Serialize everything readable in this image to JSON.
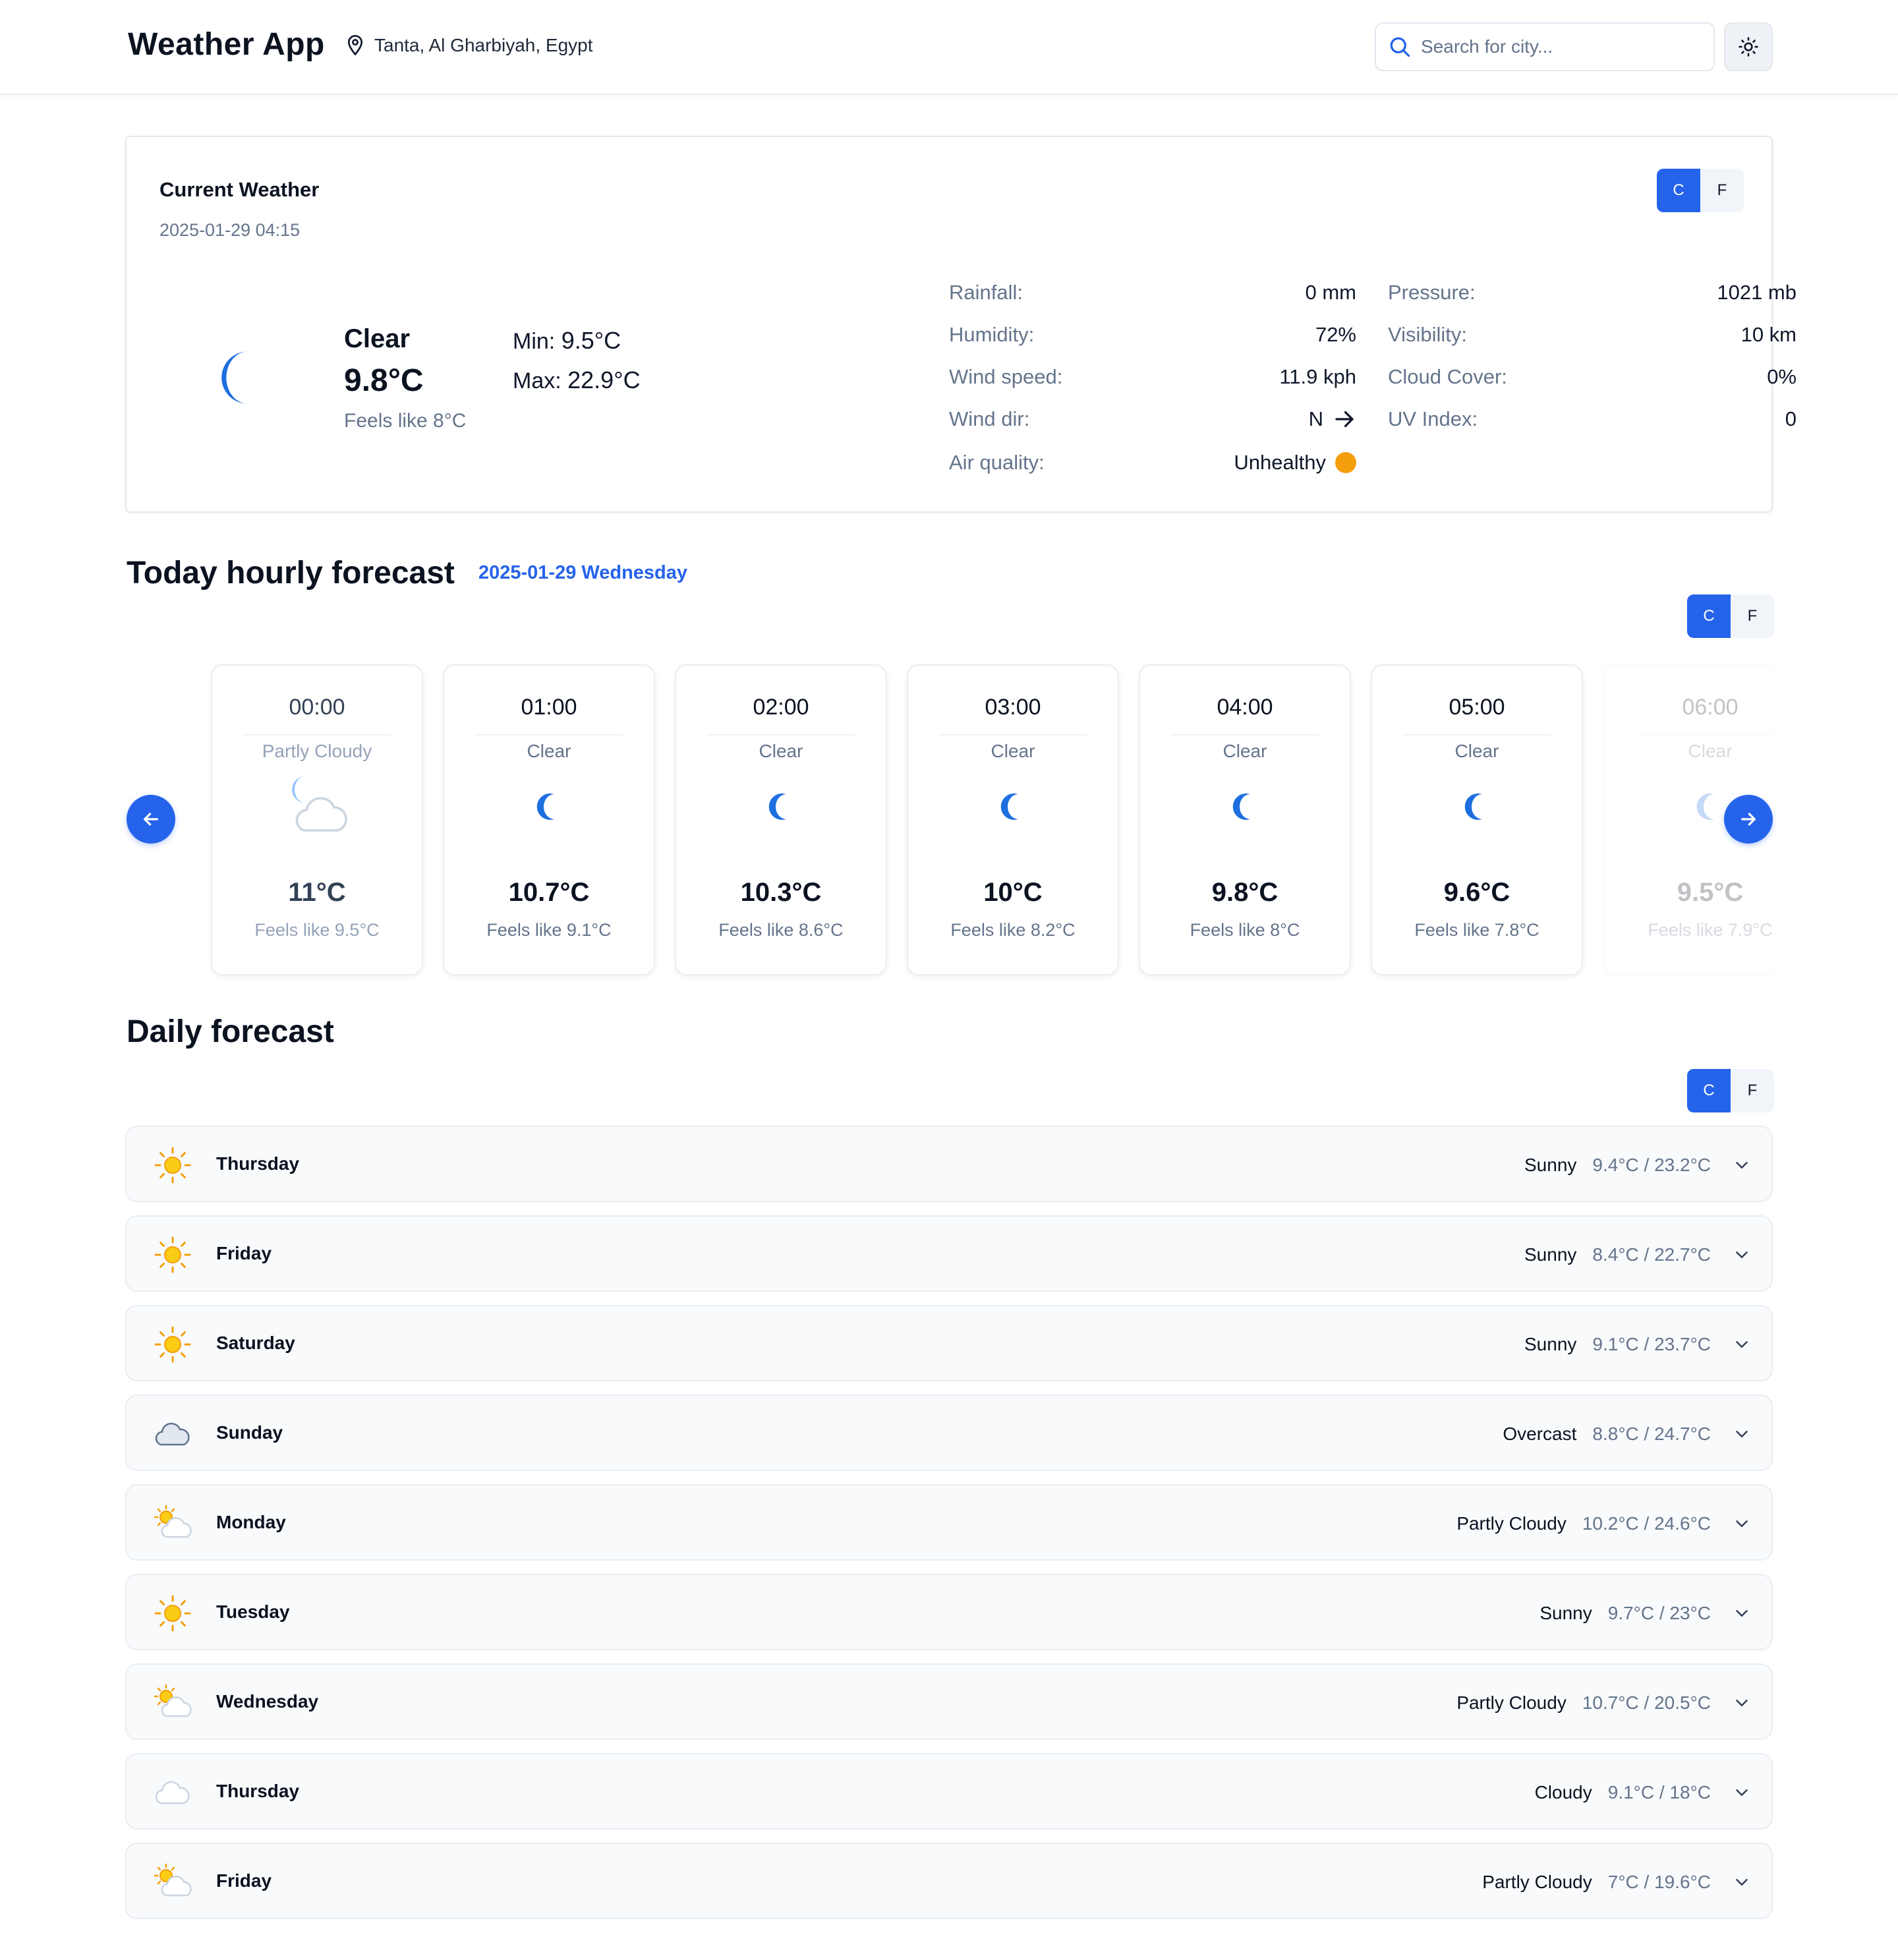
{
  "header": {
    "app_title": "Weather App",
    "location": "Tanta, Al Gharbiyah, Egypt",
    "search_placeholder": "Search for city...",
    "theme_icon": "sun-icon"
  },
  "colors": {
    "accent": "#2563eb",
    "moon": "#1d6fe0",
    "sun": "#facc15",
    "air_quality_dot": "#f59e0b",
    "muted_text": "#64748b"
  },
  "current": {
    "title": "Current Weather",
    "date": "2025-01-29 04:15",
    "unit_c": "C",
    "unit_f": "F",
    "active_unit": "C",
    "condition": "Clear",
    "icon": "moon-icon",
    "temp": "9.8°C",
    "feels": "Feels like 8°C",
    "min_label": "Min:",
    "min_value": "9.5°C",
    "max_label": "Max:",
    "max_value": "22.9°C",
    "stats_left": [
      {
        "label": "Rainfall:",
        "value": "0 mm"
      },
      {
        "label": "Humidity:",
        "value": "72%"
      },
      {
        "label": "Wind speed:",
        "value": "11.9 kph"
      },
      {
        "label": "Wind dir:",
        "value": "N"
      },
      {
        "label": "Air quality:",
        "value": "Unhealthy"
      }
    ],
    "stats_right": [
      {
        "label": "Pressure:",
        "value": "1021 mb"
      },
      {
        "label": "Visibility:",
        "value": "10 km"
      },
      {
        "label": "Cloud Cover:",
        "value": "0%"
      },
      {
        "label": "UV Index:",
        "value": "0"
      }
    ]
  },
  "hourly": {
    "title": "Today hourly forecast",
    "date": "2025-01-29 Wednesday",
    "unit_c": "C",
    "unit_f": "F",
    "active_unit": "C",
    "hours": [
      {
        "time": "00:00",
        "condition": "Partly Cloudy",
        "icon": "moon-cloud-icon",
        "temp": "11°C",
        "feels": "Feels like 9.5°C"
      },
      {
        "time": "01:00",
        "condition": "Clear",
        "icon": "moon-icon",
        "temp": "10.7°C",
        "feels": "Feels like 9.1°C"
      },
      {
        "time": "02:00",
        "condition": "Clear",
        "icon": "moon-icon",
        "temp": "10.3°C",
        "feels": "Feels like 8.6°C"
      },
      {
        "time": "03:00",
        "condition": "Clear",
        "icon": "moon-icon",
        "temp": "10°C",
        "feels": "Feels like 8.2°C"
      },
      {
        "time": "04:00",
        "condition": "Clear",
        "icon": "moon-icon",
        "temp": "9.8°C",
        "feels": "Feels like 8°C"
      },
      {
        "time": "05:00",
        "condition": "Clear",
        "icon": "moon-icon",
        "temp": "9.6°C",
        "feels": "Feels like 7.8°C"
      },
      {
        "time": "06:00",
        "condition": "Clear",
        "icon": "moon-icon",
        "temp": "9.5°C",
        "feels": "Feels like 7.9°C"
      }
    ]
  },
  "daily": {
    "title": "Daily forecast",
    "unit_c": "C",
    "unit_f": "F",
    "active_unit": "C",
    "days": [
      {
        "day": "Thursday",
        "icon": "sun-icon",
        "condition": "Sunny",
        "range": "9.4°C / 23.2°C"
      },
      {
        "day": "Friday",
        "icon": "sun-icon",
        "condition": "Sunny",
        "range": "8.4°C / 22.7°C"
      },
      {
        "day": "Saturday",
        "icon": "sun-icon",
        "condition": "Sunny",
        "range": "9.1°C / 23.7°C"
      },
      {
        "day": "Sunday",
        "icon": "overcast-cloud-icon",
        "condition": "Overcast",
        "range": "8.8°C / 24.7°C"
      },
      {
        "day": "Monday",
        "icon": "sun-cloud-icon",
        "condition": "Partly Cloudy",
        "range": "10.2°C / 24.6°C"
      },
      {
        "day": "Tuesday",
        "icon": "sun-icon",
        "condition": "Sunny",
        "range": "9.7°C / 23°C"
      },
      {
        "day": "Wednesday",
        "icon": "sun-cloud-icon",
        "condition": "Partly Cloudy",
        "range": "10.7°C / 20.5°C"
      },
      {
        "day": "Thursday",
        "icon": "cloud-icon",
        "condition": "Cloudy",
        "range": "9.1°C / 18°C"
      },
      {
        "day": "Friday",
        "icon": "sun-cloud-icon",
        "condition": "Partly Cloudy",
        "range": "7°C / 19.6°C"
      }
    ]
  }
}
